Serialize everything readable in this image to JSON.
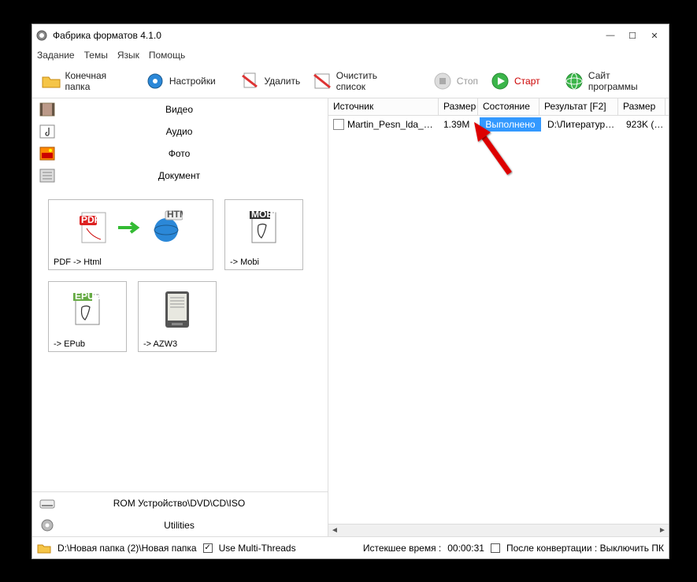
{
  "title": "Фабрика форматов 4.1.0",
  "menu": {
    "task": "Задание",
    "themes": "Темы",
    "lang": "Язык",
    "help": "Помощь"
  },
  "toolbar": {
    "final_folder": "Конечная папка",
    "settings": "Настройки",
    "delete": "Удалить",
    "clear_list": "Очистить список",
    "stop": "Стоп",
    "start": "Старт",
    "site": "Сайт программы"
  },
  "categories": {
    "video": "Видео",
    "audio": "Аудио",
    "photo": "Фото",
    "document": "Документ",
    "rom": "ROM Устройство\\DVD\\CD\\ISO",
    "utilities": "Utilities"
  },
  "tiles": {
    "pdf_html": "PDF -> Html",
    "mobi": "-> Mobi",
    "epub": "-> EPub",
    "azw3": "-> AZW3"
  },
  "columns": {
    "source": "Источник",
    "size": "Размер",
    "state": "Состояние",
    "result": "Результат [F2]",
    "size2": "Размер"
  },
  "row": {
    "source": "Martin_Pesn_lda_i_pl...",
    "size": "1.39M",
    "state": "Выполнено",
    "result": "D:\\Литература\\...",
    "size2": "923K  (64"
  },
  "status": {
    "path": "D:\\Новая папка (2)\\Новая папка",
    "multithreads": "Use Multi-Threads",
    "elapsed_label": "Истекшее время :",
    "elapsed_time": "00:00:31",
    "after_conv": "После конвертации : Выключить ПК"
  }
}
